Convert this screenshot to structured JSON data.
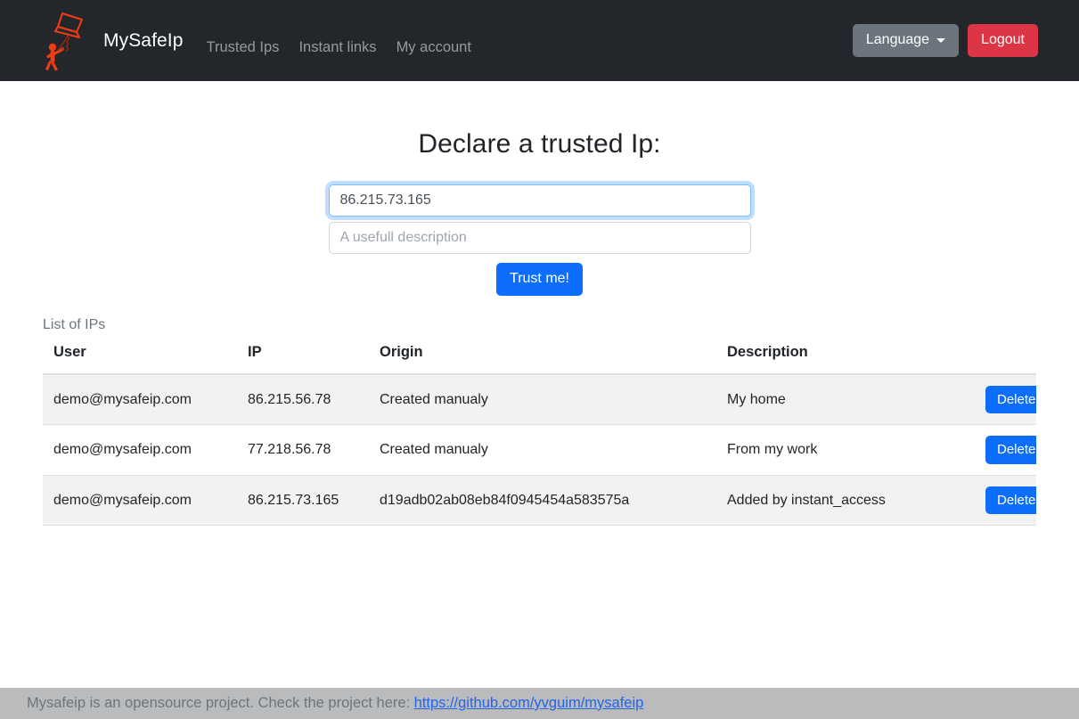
{
  "navbar": {
    "brand": "MySafeIp",
    "logo_alt": "kite-logo",
    "links": [
      {
        "label": "Trusted Ips"
      },
      {
        "label": "Instant links"
      },
      {
        "label": "My account"
      }
    ],
    "language_button": "Language",
    "logout_button": "Logout"
  },
  "main": {
    "title": "Declare a trusted Ip:",
    "ip_input": {
      "value": "86.215.73.165",
      "placeholder": "86.215.73.165"
    },
    "description_input": {
      "value": "",
      "placeholder": "A usefull description"
    },
    "submit_button": "Trust me!"
  },
  "table": {
    "caption": "List of IPs",
    "headers": [
      "User",
      "IP",
      "Origin",
      "Description",
      ""
    ],
    "action_label": "Delete",
    "rows": [
      {
        "user": "demo@mysafeip.com",
        "ip": "86.215.56.78",
        "origin": "Created manualy",
        "description": "My home",
        "action": "Delete"
      },
      {
        "user": "demo@mysafeip.com",
        "ip": "77.218.56.78",
        "origin": "Created manualy",
        "description": "From my work",
        "action": "Delete"
      },
      {
        "user": "demo@mysafeip.com",
        "ip": "86.215.73.165",
        "origin": "d19adb02ab08eb84f0945454a583575a",
        "description": "Added by instant_access",
        "action": "Delete"
      }
    ]
  },
  "footer": {
    "text": "Mysafeip is an opensource project. Check the project here:",
    "link": "https://github.com/yvguim/mysafeip"
  },
  "colors": {
    "navbar_bg": "#23272b",
    "primary": "#0d6efd",
    "danger": "#dc3545",
    "secondary": "#6c757d",
    "footer_bg": "#b9bbbd",
    "logo_red": "#f03c14",
    "row_stripe": "#f2f2f2",
    "link": "#2563eb"
  }
}
